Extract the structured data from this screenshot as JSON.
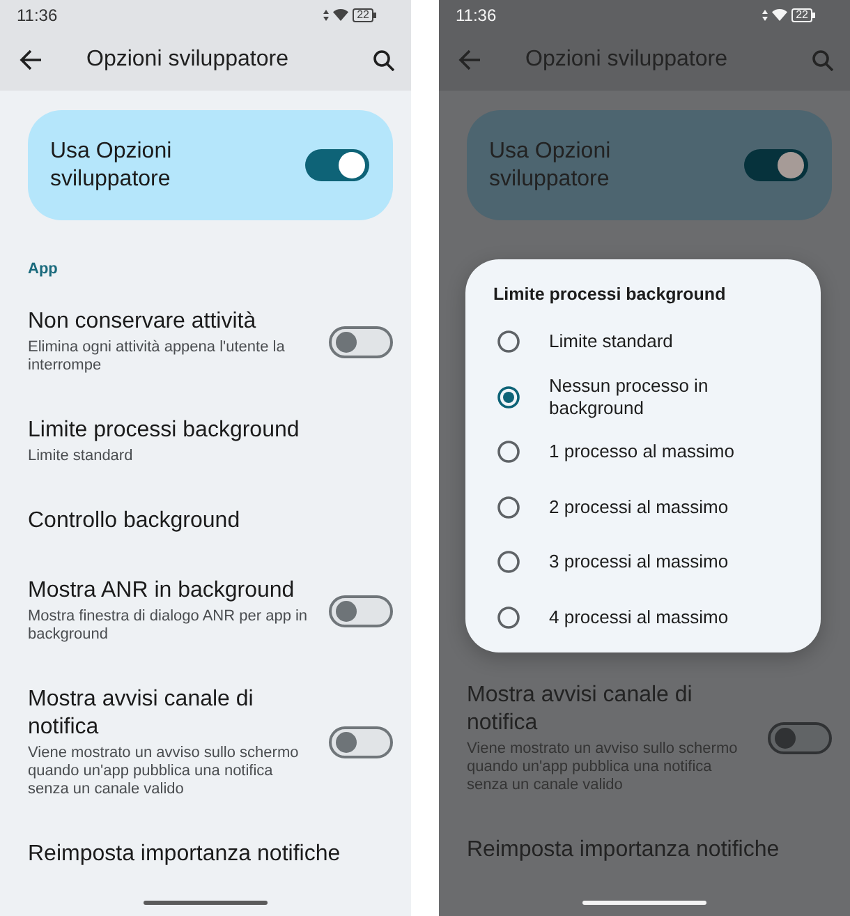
{
  "screens": [
    {
      "dimmed": false,
      "status_bar": {
        "time": "11:36",
        "battery": "22"
      },
      "app_bar": {
        "title": "Opzioni sviluppatore"
      },
      "main_switch": {
        "label": "Usa Opzioni sviluppatore",
        "on": true
      },
      "section_header": "App",
      "settings": [
        {
          "kind": "switch",
          "title": "Non conservare attività",
          "summary": "Elimina ogni attività appena l'utente la interrompe",
          "on": false
        },
        {
          "kind": "plain",
          "title": "Limite processi background",
          "summary": "Limite standard"
        },
        {
          "kind": "plain",
          "title": "Controllo background"
        },
        {
          "kind": "switch",
          "title": "Mostra ANR in background",
          "summary": "Mostra finestra di dialogo ANR per app in background",
          "on": false
        },
        {
          "kind": "switch",
          "title": "Mostra avvisi canale di notifica",
          "summary": "Viene mostrato un avviso sullo schermo quando un'app pubblica una notifica senza un canale valido",
          "on": false
        },
        {
          "kind": "plain",
          "title": "Reimposta importanza notifiche"
        }
      ]
    },
    {
      "dimmed": true,
      "status_bar": {
        "time": "11:36",
        "battery": "22"
      },
      "app_bar": {
        "title": "Opzioni sviluppatore"
      },
      "main_switch": {
        "label": "Usa Opzioni sviluppatore",
        "on": true
      },
      "dialog": {
        "title": "Limite processi background",
        "options": [
          {
            "label": "Limite standard",
            "selected": false
          },
          {
            "label": "Nessun processo in background",
            "selected": true
          },
          {
            "label": "1 processo al massimo",
            "selected": false
          },
          {
            "label": "2 processi al massimo",
            "selected": false
          },
          {
            "label": "3 processi al massimo",
            "selected": false
          },
          {
            "label": "4 processi al massimo",
            "selected": false
          }
        ]
      },
      "settings": [
        {
          "kind": "switch",
          "title": "Mostra avvisi canale di notifica",
          "summary": "Viene mostrato un avviso sullo schermo quando un'app pubblica una notifica senza un canale valido",
          "on": false
        },
        {
          "kind": "plain",
          "title": "Reimposta importanza notifiche"
        }
      ]
    }
  ]
}
